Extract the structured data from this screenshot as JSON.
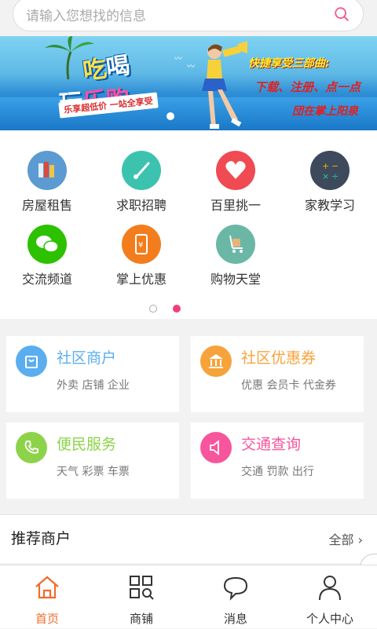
{
  "search": {
    "placeholder": "请输入您想找的信息",
    "icon": "search-icon"
  },
  "banner": {
    "title_line1_a": "吃",
    "title_line1_b": "喝",
    "title_line2_a": "玩",
    "title_line2_b": "乐购",
    "slogan": "乐享超低价 一站全享受",
    "right_line1": "快捷享受三部曲:",
    "right_line2": "下载、注册、点一点",
    "right_line3": "団在掌上阳泉"
  },
  "categories": [
    {
      "label": "房屋租售",
      "icon": "books-icon",
      "color": "#5b9bd1"
    },
    {
      "label": "求职招聘",
      "icon": "brush-icon",
      "color": "#3cc3b0"
    },
    {
      "label": "百里挑一",
      "icon": "heart-icon",
      "color": "#f04a52"
    },
    {
      "label": "家教学习",
      "icon": "calculator-icon",
      "color": "#3c4a5c"
    },
    {
      "label": "交流频道",
      "icon": "wechat-icon",
      "color": "#2dc100"
    },
    {
      "label": "掌上优惠",
      "icon": "phone-yen-icon",
      "color": "#f37d1c"
    },
    {
      "label": "购物天堂",
      "icon": "cart-icon",
      "color": "#6ab7a5"
    }
  ],
  "pager": {
    "count": 2,
    "active": 2
  },
  "services": [
    {
      "title": "社区商户",
      "subtitle": "外卖 店铺 企业",
      "color": "#5aaef0",
      "title_color": "#5aaef0",
      "icon": "bag-icon"
    },
    {
      "title": "社区优惠券",
      "subtitle": "优惠 会员卡 代金券",
      "color": "#f6a33b",
      "title_color": "#f6a33b",
      "icon": "bank-icon"
    },
    {
      "title": "便民服务",
      "subtitle": "天气 彩票 车票",
      "color": "#8dd34a",
      "title_color": "#8dd34a",
      "icon": "phone-icon"
    },
    {
      "title": "交通查询",
      "subtitle": "交通 罚款 出行",
      "color": "#f7559c",
      "title_color": "#f7559c",
      "icon": "speaker-icon"
    }
  ],
  "recommend": {
    "title": "推荐商户",
    "all": "全部"
  },
  "tabs": [
    {
      "label": "首页",
      "icon": "home-icon",
      "active": true
    },
    {
      "label": "商铺",
      "icon": "shops-icon",
      "active": false
    },
    {
      "label": "消息",
      "icon": "message-icon",
      "active": false
    },
    {
      "label": "个人中心",
      "icon": "user-icon",
      "active": false
    }
  ],
  "colors": {
    "accent": "#f06c2c",
    "pager_active": "#f0407a"
  }
}
